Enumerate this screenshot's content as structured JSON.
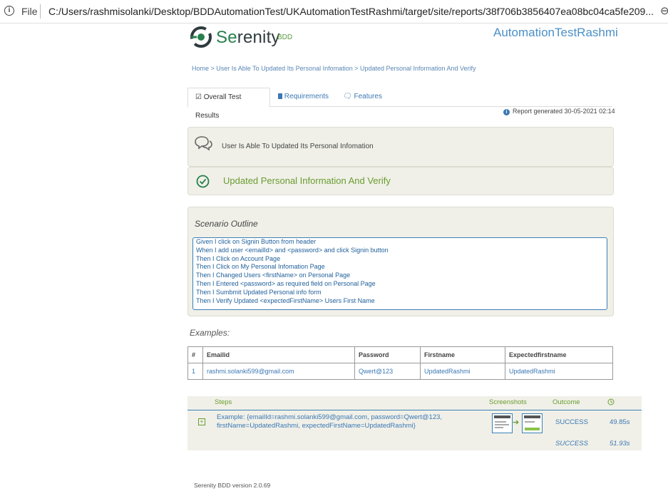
{
  "browser": {
    "file_label": "File",
    "url": "C:/Users/rashmisolanki/Desktop/BDDAutomationTest/UKAutomationTestRashmi/target/site/reports/38f706b3856407ea08bc04ca5fe209..."
  },
  "header": {
    "logo_se": "Se",
    "logo_rest": "renity",
    "logo_bdd": "BDD",
    "project_name": "AutomationTestRashmi"
  },
  "breadcrumb": "Home > User Is Able To Updated Its Personal Infomation > Updated Personal Information And Verify",
  "tabs": [
    {
      "label": "Overall Test Results",
      "icon": "checkbox-icon"
    },
    {
      "label": "Requirements",
      "icon": "book-icon"
    },
    {
      "label": "Features",
      "icon": "comments-icon"
    }
  ],
  "report_generated": "Report generated 30-05-2021 02:14",
  "story_title": "User Is Able To Updated Its Personal Infomation",
  "scenario_title": "Updated Personal Information And Verify",
  "outline": {
    "label": "Scenario Outline",
    "steps": [
      "Given I click on Signin Button from header",
      "When I add user <emailId> and <password> and click Signin button",
      "Then I Click on Account Page",
      "Then I Click on My Personal Infomation Page",
      "Then I Changed Users <firstName> on Personal Page",
      "Then I Entered <password> as required field on Personal Page",
      "Then I Sumbmit Updated Personal info form",
      "Then I Verify Updated <expectedFirstName> Users First Name"
    ]
  },
  "examples": {
    "label": "Examples:",
    "headers": [
      "#",
      "Emailid",
      "Password",
      "Firstname",
      "Expectedfirstname"
    ],
    "rows": [
      [
        "1",
        "rashmi.solanki599@gmail.com",
        "Qwert@123",
        "UpdatedRashmi",
        "UpdatedRashmi"
      ]
    ]
  },
  "steps_table": {
    "headers": {
      "steps": "Steps",
      "screenshots": "Screenshots",
      "outcome": "Outcome"
    },
    "example_line1": "Example: {emailId=rashmi.solanki599@gmail.com, password=Qwert@123,",
    "example_line2": "firstName=UpdatedRashmi, expectedFirstName=UpdatedRashmi}",
    "outcome": "SUCCESS",
    "duration": "49.85s",
    "total_outcome": "SUCCESS",
    "total_duration": "51.93s"
  },
  "footer": "Serenity BDD version 2.0.69",
  "colors": {
    "accent": "#3c78b4",
    "success": "#6a9c30",
    "panel": "#f0f0e8"
  }
}
